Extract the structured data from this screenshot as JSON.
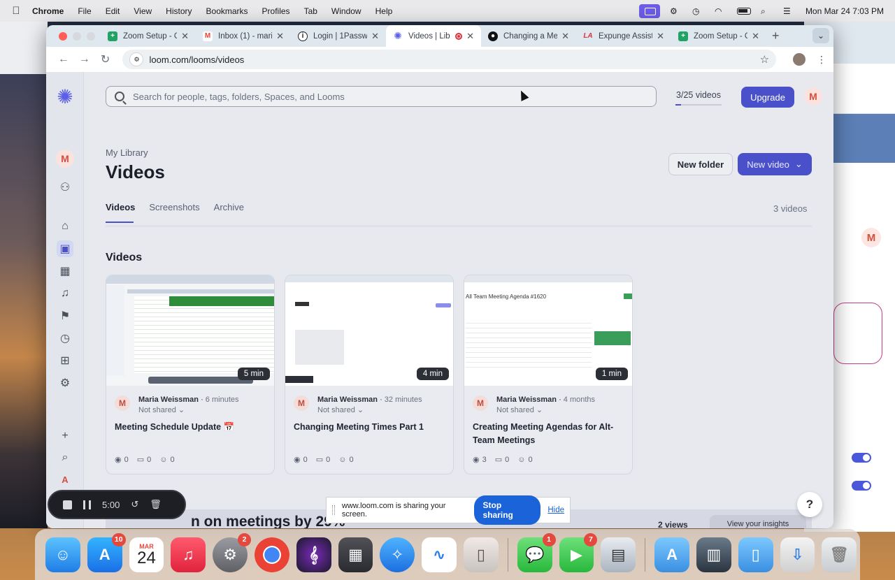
{
  "menubar": {
    "app": "Chrome",
    "items": [
      "File",
      "Edit",
      "View",
      "History",
      "Bookmarks",
      "Profiles",
      "Tab",
      "Window",
      "Help"
    ],
    "clock": "Mon Mar 24  7:03 PM"
  },
  "browser": {
    "tabs": [
      {
        "label": "Zoom Setup - G",
        "favicon_color": "#21a366",
        "favicon": "sheets-icon"
      },
      {
        "label": "Inbox (1) - mari",
        "favicon_color": "#ea4335",
        "favicon": "gmail-icon"
      },
      {
        "label": "Login | 1Passwo",
        "favicon_color": "#1a1a1a",
        "favicon": "onepassword-icon"
      },
      {
        "label": "Videos | Lib",
        "favicon_color": "#5b5ee6",
        "favicon": "loom-icon",
        "active": true,
        "recording": true
      },
      {
        "label": "Changing a Me",
        "favicon_color": "#111111",
        "favicon": "github-icon"
      },
      {
        "label": "Expunge Assist",
        "favicon_color": "#e0333c",
        "favicon": "expunge-icon"
      },
      {
        "label": "Zoom Setup - G",
        "favicon_color": "#21a366",
        "favicon": "sheets-icon"
      }
    ],
    "url": "loom.com/looms/videos"
  },
  "loom": {
    "search_placeholder": "Search for people, tags, folders, Spaces, and Looms",
    "quota": "3/25 videos",
    "quota_fraction": 0.12,
    "upgrade": "Upgrade",
    "avatar_letter": "M",
    "breadcrumb": "My Library",
    "title": "Videos",
    "new_folder": "New folder",
    "new_video": "New video",
    "tabs": [
      "Videos",
      "Screenshots",
      "Archive"
    ],
    "video_count": "3 videos",
    "section_title": "Videos",
    "cards": [
      {
        "author": "Maria Weissman",
        "ago": "6 minutes",
        "share": "Not shared",
        "title": "Meeting Schedule Update 📅",
        "duration": "5 min",
        "views": "0",
        "comments": "0",
        "reactions": "0",
        "thumb_accent": "#2f8c3b"
      },
      {
        "author": "Maria Weissman",
        "ago": "32 minutes",
        "share": "Not shared",
        "title": "Changing Meeting Times Part 1",
        "duration": "4 min",
        "views": "0",
        "comments": "0",
        "reactions": "0",
        "thumb_accent": "#8b8ee8"
      },
      {
        "author": "Maria Weissman",
        "ago": "4 months",
        "share": "Not shared",
        "title": "Creating Meeting Agendas for Alt-Team Meetings",
        "duration": "1 min",
        "views": "3",
        "comments": "0",
        "reactions": "0",
        "thumb_accent": "#3b9d5a",
        "thumb_heading": "All Team Meeting Agenda #1620"
      }
    ],
    "promo_text": "n on meetings by 29%",
    "promo_views": "2 views",
    "promo_insights": "View your insights",
    "help": "?"
  },
  "recorder": {
    "time": "5:00"
  },
  "share_notice": {
    "text": "www.loom.com is sharing your screen.",
    "stop": "Stop sharing",
    "hide": "Hide"
  },
  "dock": {
    "calendar_month": "MAR",
    "calendar_day": "24",
    "badges": {
      "appstore": "10",
      "settings": "2",
      "messages": "1",
      "facetime": "7"
    }
  }
}
